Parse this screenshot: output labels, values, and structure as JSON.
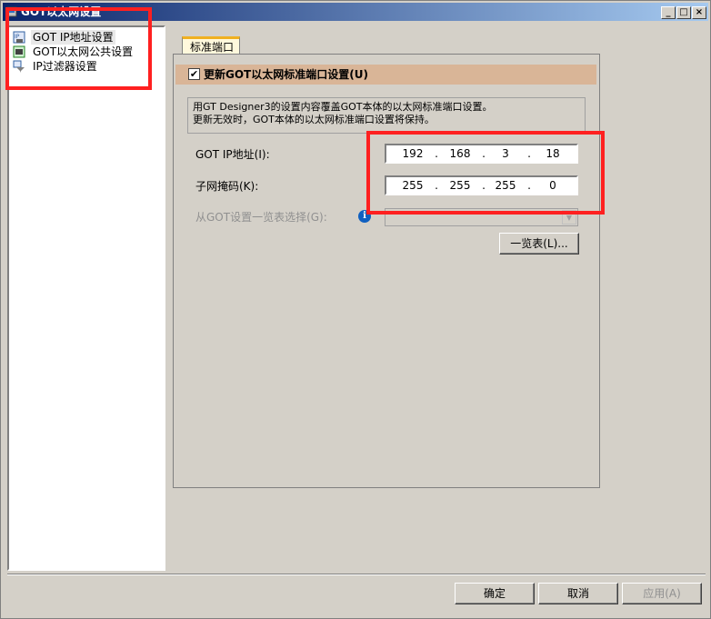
{
  "window": {
    "title": "GOT以太网设置",
    "controls": [
      "_",
      "□",
      "×"
    ]
  },
  "tree": {
    "items": [
      {
        "label": "GOT IP地址设置",
        "icon": "ip-address-icon",
        "selected": true
      },
      {
        "label": "GOT以太网公共设置",
        "icon": "network-settings-icon",
        "selected": false
      },
      {
        "label": "IP过滤器设置",
        "icon": "ip-filter-icon",
        "selected": false
      }
    ]
  },
  "tabs": [
    {
      "label": "标准端口",
      "active": true
    }
  ],
  "panel": {
    "update_checkbox": {
      "label": "更新GOT以太网标准端口设置(U)",
      "checked": true,
      "check_mark": "✔"
    },
    "info_text_1": "用GT Designer3的设置内容覆盖GOT本体的以太网标准端口设置。",
    "info_text_2": "更新无效时，GOT本体的以太网标准端口设置将保持。",
    "ip_label": "GOT IP地址(I):",
    "ip_value": [
      "192",
      "168",
      "3",
      "18"
    ],
    "subnet_label": "子网掩码(K):",
    "subnet_value": [
      "255",
      "255",
      "255",
      "0"
    ],
    "select_label": "从GOT设置一览表选择(G):",
    "select_value": "",
    "list_button": "一览表(L)...",
    "ip_dot": "."
  },
  "footer": {
    "ok": "确定",
    "cancel": "取消",
    "apply": "应用(A)"
  },
  "colors": {
    "annotation": "#ff2020",
    "header_bar": "#d9b597",
    "tab_accent": "#f0b020"
  }
}
